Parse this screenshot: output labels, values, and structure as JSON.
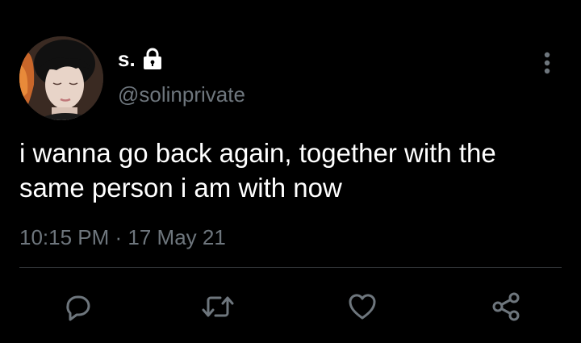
{
  "tweet": {
    "display_name": "s.",
    "handle": "@solinprivate",
    "text": "i wanna go back again, together with the same person i am with now",
    "timestamp": "10:15 PM · 17 May 21",
    "protected_icon": "lock-icon"
  },
  "actions": [
    {
      "icon": "reply-icon"
    },
    {
      "icon": "retweet-icon"
    },
    {
      "icon": "like-icon"
    },
    {
      "icon": "share-icon"
    }
  ],
  "colors": {
    "background": "#000000",
    "text_primary": "#ffffff",
    "text_secondary": "#6e767d",
    "divider": "#2f3336"
  }
}
